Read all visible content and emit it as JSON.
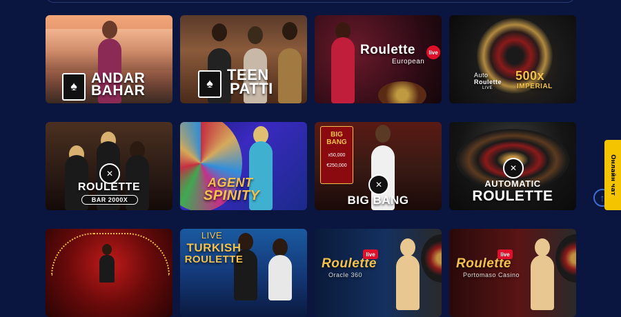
{
  "cards": [
    {
      "title_line1": "ANDAR",
      "title_line2": "BAHAR"
    },
    {
      "title_line1": "TEEN",
      "title_line2": "PATTI"
    },
    {
      "title": "Roulette",
      "badge": "live",
      "subtitle": "European"
    },
    {
      "line1": "Auto",
      "line2": "Roulette",
      "line3": "LIVE",
      "multiplier": "500x",
      "edition": "IMPERIAL"
    },
    {
      "title": "ROULETTE",
      "subtitle": "BAR 2000X"
    },
    {
      "title_line1": "AGENT",
      "title_line2": "SPINITY"
    },
    {
      "title": "BIG BANG",
      "sign1": "BIG",
      "sign2": "BANG",
      "sign3": "x50,000",
      "sign4": "€250,000"
    },
    {
      "title_line1": "AUTOMATIC",
      "title_line2": "ROULETTE"
    },
    {},
    {
      "title_line1": "LIVE",
      "title_line2": "TURKISH",
      "title_line3": "ROULETTE"
    },
    {
      "title": "Roulette",
      "badge": "live",
      "subtitle": "Oracle 360"
    },
    {
      "title": "Roulette",
      "badge": "live",
      "subtitle": "Portomaso Casino"
    }
  ],
  "chat": {
    "label": "Онлайн чат"
  },
  "scroll_up": {
    "icon": "arrow-up-icon",
    "glyph": "↑"
  },
  "colors": {
    "background": "#0a1540",
    "chat_tab": "#f5c400",
    "accent_gold": "#f2c14e",
    "live_red": "#e0102a"
  }
}
